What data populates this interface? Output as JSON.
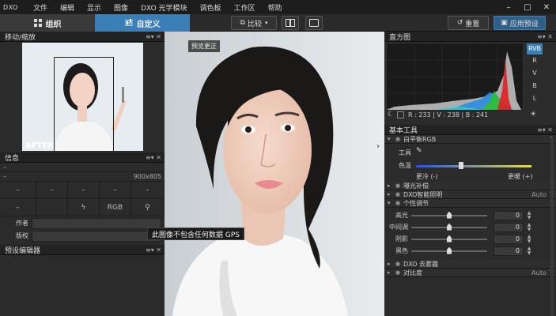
{
  "menubar": {
    "logo": "DXO",
    "items": [
      "文件",
      "编辑",
      "显示",
      "图像",
      "DXO 光学模块",
      "调色板",
      "工作区",
      "帮助"
    ],
    "window_controls": [
      "–",
      "□",
      "✕"
    ]
  },
  "toolbar": {
    "tab_organize": "组织",
    "tab_customize": "自定义",
    "compare_label": "比较",
    "reset_label": "重置",
    "apply_preset_label": "应用预设"
  },
  "left": {
    "navigator_title": "移动/缩放",
    "after_label": "AFTER",
    "info_title": "信息",
    "dim_text": "900x805",
    "placeholder": "–",
    "rgb_label": "RGB",
    "author_label": "作者",
    "copyright_label": "版权",
    "gps_tooltip": "此图像不包含任何数据 GPS",
    "preset_editor_title": "预设编辑器"
  },
  "center": {
    "preset_badge": "预览更正"
  },
  "right": {
    "histogram_title": "直方图",
    "channels": [
      "RVB",
      "R",
      "V",
      "B",
      "L"
    ],
    "readout": "R : 233  |  V : 238  |  B : 241",
    "basic_tools_title": "基本工具",
    "wb_title": "白平衡RGB",
    "wb_tool_label": "工具",
    "wb_temp_label": "色温",
    "wb_cooler": "更冷 (-)",
    "wb_warmer": "更暖 (+)",
    "exposure_title": "曝光补偿",
    "smart_light_title": "DXO智能照明",
    "smart_light_value": "Auto",
    "selective_tone_title": "个性调节",
    "tone_sliders": [
      {
        "label": "高光",
        "value": "0",
        "level": 0.5
      },
      {
        "label": "中间调",
        "value": "0",
        "level": 0.5
      },
      {
        "label": "阴影",
        "value": "0",
        "level": 0.5
      },
      {
        "label": "黑色",
        "value": "0",
        "level": 0.5
      }
    ],
    "clearview_title": "DXO 去雾霾",
    "contrast_title": "对比度",
    "contrast_value": "Auto"
  },
  "colors": {
    "accent": "#3c7fb6",
    "panel": "#2b2b2b",
    "header": "#222222"
  }
}
